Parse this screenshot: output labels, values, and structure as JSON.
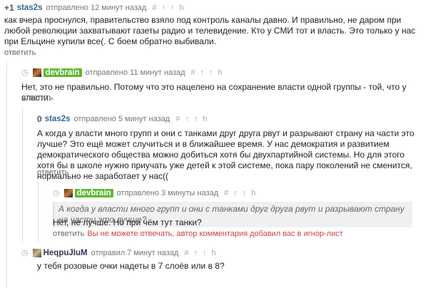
{
  "comments": [
    {
      "score": "+1",
      "user": "stas2s",
      "posted": "отправлено 12 минут назад",
      "text": "как вчера проснулся, правительство взяло под контроль каналы давно. И правильно, не даром при любой революции захватывают газеты радио и телевидение. Кто у СМИ тот и власть. Это только у нас при Ельцине купили все(. С боем обратно выбивали.",
      "reply": "ответить"
    },
    {
      "user": "devbrain",
      "posted": "отправлено 11 минут назад",
      "text": "Нет, это не правильно. Потому что это нацелено на сохранение власти одной группы - той, что у власти.",
      "reply": "ответить"
    },
    {
      "score": "0",
      "user": "stas2s",
      "posted": "отправлено 5 минут назад",
      "text": "А когда у власти много групп и они с танками друг друга рвут и разрывают страну на части это лучше? Это ещё может случиться и в ближайшее время. У нас демократия и развитием демократического общества можно добиться хотя бы двухпартийной системы. Но для этого хотя бы в школе нужно приучать уже детей к этой системе, пока пару поколений не сменится, нормально не заработает у нас((",
      "reply": "ответить"
    },
    {
      "user": "devbrain",
      "posted": "отправлено 3 минуты назад",
      "quote": "А когда у власти много групп и они с танками друг друга рвут и разрывают страну на части это лучше?",
      "text": "Нет, не лучше. Но при чём тут танки?",
      "reply": "ответить",
      "warning": "Вы не можете отвечать, автор комментария добавил вас в игнор-лист"
    },
    {
      "user": "HeqpuJIuM",
      "posted": "отправил 7 минут назад",
      "text": "у тебя розовые очки надеты в 7 слоёв или в 8?"
    }
  ],
  "tools": {
    "hash": "#",
    "up": "↑",
    "tree": "↑",
    "parent": "h"
  },
  "colors": {
    "link": "#336699",
    "badge": "#5fb832",
    "warning": "#d04040"
  }
}
